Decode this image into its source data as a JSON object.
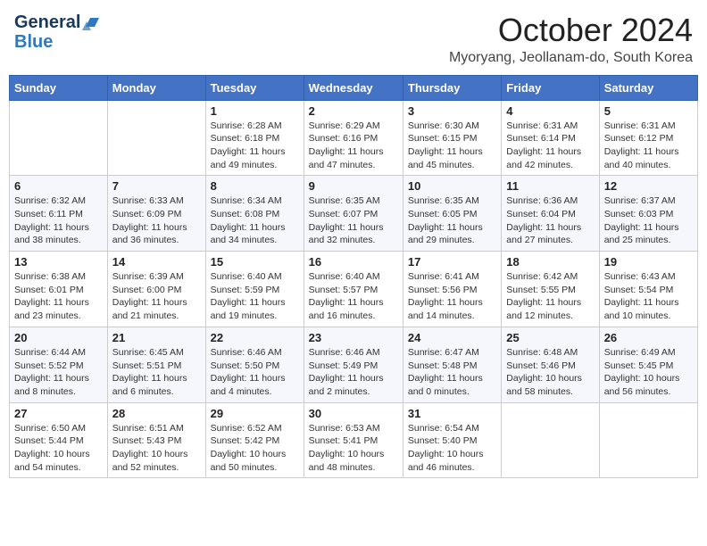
{
  "logo": {
    "line1": "General",
    "line2": "Blue"
  },
  "header": {
    "month": "October 2024",
    "location": "Myoryang, Jeollanam-do, South Korea"
  },
  "weekdays": [
    "Sunday",
    "Monday",
    "Tuesday",
    "Wednesday",
    "Thursday",
    "Friday",
    "Saturday"
  ],
  "weeks": [
    [
      {
        "day": "",
        "info": ""
      },
      {
        "day": "",
        "info": ""
      },
      {
        "day": "1",
        "info": "Sunrise: 6:28 AM\nSunset: 6:18 PM\nDaylight: 11 hours and 49 minutes."
      },
      {
        "day": "2",
        "info": "Sunrise: 6:29 AM\nSunset: 6:16 PM\nDaylight: 11 hours and 47 minutes."
      },
      {
        "day": "3",
        "info": "Sunrise: 6:30 AM\nSunset: 6:15 PM\nDaylight: 11 hours and 45 minutes."
      },
      {
        "day": "4",
        "info": "Sunrise: 6:31 AM\nSunset: 6:14 PM\nDaylight: 11 hours and 42 minutes."
      },
      {
        "day": "5",
        "info": "Sunrise: 6:31 AM\nSunset: 6:12 PM\nDaylight: 11 hours and 40 minutes."
      }
    ],
    [
      {
        "day": "6",
        "info": "Sunrise: 6:32 AM\nSunset: 6:11 PM\nDaylight: 11 hours and 38 minutes."
      },
      {
        "day": "7",
        "info": "Sunrise: 6:33 AM\nSunset: 6:09 PM\nDaylight: 11 hours and 36 minutes."
      },
      {
        "day": "8",
        "info": "Sunrise: 6:34 AM\nSunset: 6:08 PM\nDaylight: 11 hours and 34 minutes."
      },
      {
        "day": "9",
        "info": "Sunrise: 6:35 AM\nSunset: 6:07 PM\nDaylight: 11 hours and 32 minutes."
      },
      {
        "day": "10",
        "info": "Sunrise: 6:35 AM\nSunset: 6:05 PM\nDaylight: 11 hours and 29 minutes."
      },
      {
        "day": "11",
        "info": "Sunrise: 6:36 AM\nSunset: 6:04 PM\nDaylight: 11 hours and 27 minutes."
      },
      {
        "day": "12",
        "info": "Sunrise: 6:37 AM\nSunset: 6:03 PM\nDaylight: 11 hours and 25 minutes."
      }
    ],
    [
      {
        "day": "13",
        "info": "Sunrise: 6:38 AM\nSunset: 6:01 PM\nDaylight: 11 hours and 23 minutes."
      },
      {
        "day": "14",
        "info": "Sunrise: 6:39 AM\nSunset: 6:00 PM\nDaylight: 11 hours and 21 minutes."
      },
      {
        "day": "15",
        "info": "Sunrise: 6:40 AM\nSunset: 5:59 PM\nDaylight: 11 hours and 19 minutes."
      },
      {
        "day": "16",
        "info": "Sunrise: 6:40 AM\nSunset: 5:57 PM\nDaylight: 11 hours and 16 minutes."
      },
      {
        "day": "17",
        "info": "Sunrise: 6:41 AM\nSunset: 5:56 PM\nDaylight: 11 hours and 14 minutes."
      },
      {
        "day": "18",
        "info": "Sunrise: 6:42 AM\nSunset: 5:55 PM\nDaylight: 11 hours and 12 minutes."
      },
      {
        "day": "19",
        "info": "Sunrise: 6:43 AM\nSunset: 5:54 PM\nDaylight: 11 hours and 10 minutes."
      }
    ],
    [
      {
        "day": "20",
        "info": "Sunrise: 6:44 AM\nSunset: 5:52 PM\nDaylight: 11 hours and 8 minutes."
      },
      {
        "day": "21",
        "info": "Sunrise: 6:45 AM\nSunset: 5:51 PM\nDaylight: 11 hours and 6 minutes."
      },
      {
        "day": "22",
        "info": "Sunrise: 6:46 AM\nSunset: 5:50 PM\nDaylight: 11 hours and 4 minutes."
      },
      {
        "day": "23",
        "info": "Sunrise: 6:46 AM\nSunset: 5:49 PM\nDaylight: 11 hours and 2 minutes."
      },
      {
        "day": "24",
        "info": "Sunrise: 6:47 AM\nSunset: 5:48 PM\nDaylight: 11 hours and 0 minutes."
      },
      {
        "day": "25",
        "info": "Sunrise: 6:48 AM\nSunset: 5:46 PM\nDaylight: 10 hours and 58 minutes."
      },
      {
        "day": "26",
        "info": "Sunrise: 6:49 AM\nSunset: 5:45 PM\nDaylight: 10 hours and 56 minutes."
      }
    ],
    [
      {
        "day": "27",
        "info": "Sunrise: 6:50 AM\nSunset: 5:44 PM\nDaylight: 10 hours and 54 minutes."
      },
      {
        "day": "28",
        "info": "Sunrise: 6:51 AM\nSunset: 5:43 PM\nDaylight: 10 hours and 52 minutes."
      },
      {
        "day": "29",
        "info": "Sunrise: 6:52 AM\nSunset: 5:42 PM\nDaylight: 10 hours and 50 minutes."
      },
      {
        "day": "30",
        "info": "Sunrise: 6:53 AM\nSunset: 5:41 PM\nDaylight: 10 hours and 48 minutes."
      },
      {
        "day": "31",
        "info": "Sunrise: 6:54 AM\nSunset: 5:40 PM\nDaylight: 10 hours and 46 minutes."
      },
      {
        "day": "",
        "info": ""
      },
      {
        "day": "",
        "info": ""
      }
    ]
  ]
}
